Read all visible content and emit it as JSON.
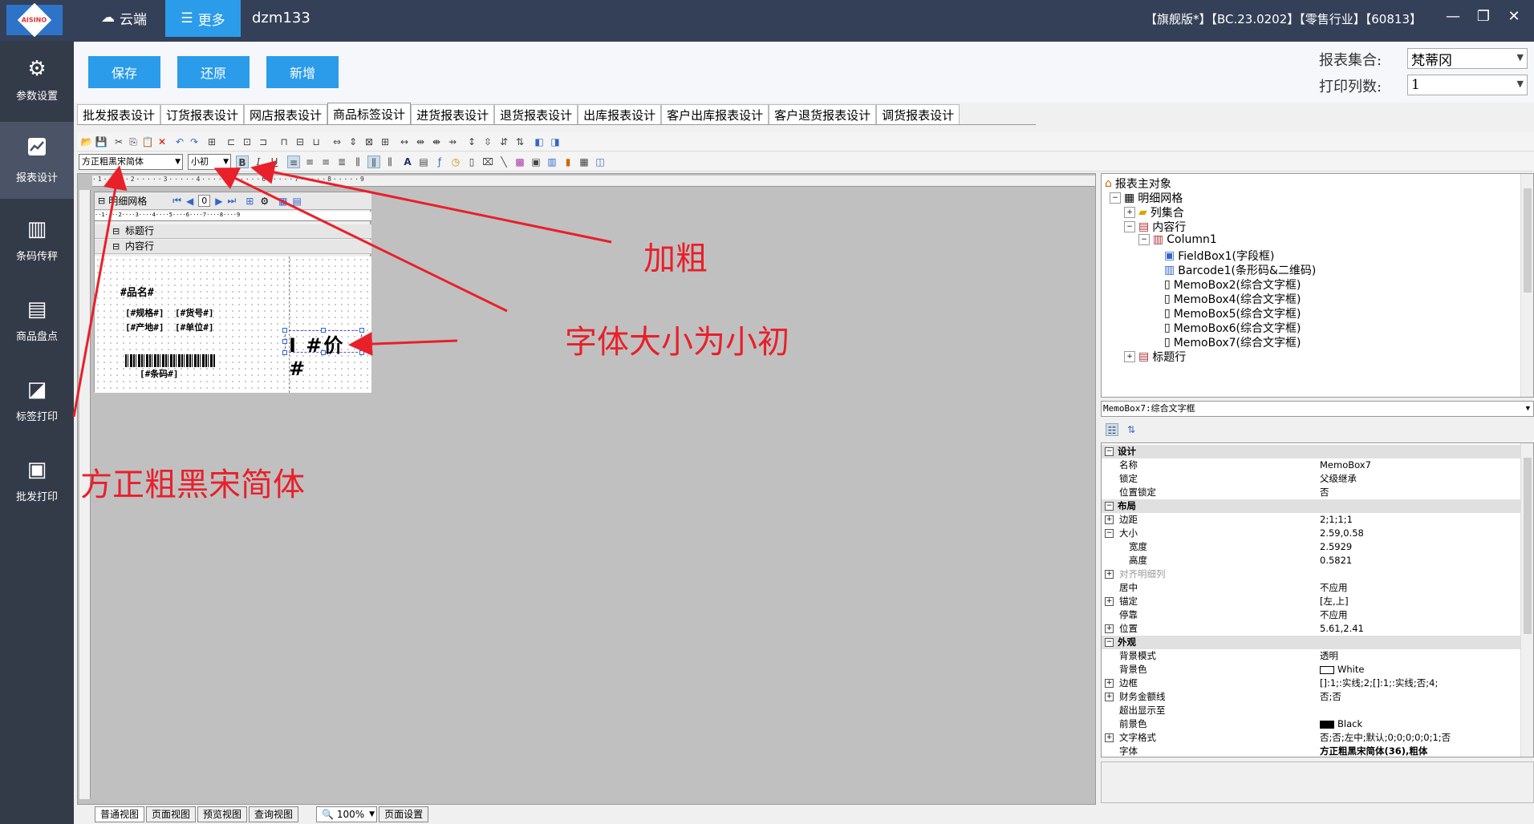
{
  "titlebar": {
    "logo_text": "AISINO",
    "cloud_label": "云端",
    "more_label": "更多",
    "user": "dzm133",
    "info": "【旗舰版*】【BC.23.0202】【零售行业】【60813】",
    "controls": [
      "—",
      "❐",
      "✕"
    ]
  },
  "sidebar": {
    "items": [
      {
        "label": "参数设置",
        "icon": "gear-icon",
        "glyph": "⚙"
      },
      {
        "label": "报表设计",
        "icon": "chart-icon",
        "glyph": "📈"
      },
      {
        "label": "条码传秤",
        "icon": "barcode-icon",
        "glyph": "▥"
      },
      {
        "label": "商品盘点",
        "icon": "inventory-icon",
        "glyph": "▤"
      },
      {
        "label": "标签打印",
        "icon": "label-icon",
        "glyph": "◪"
      },
      {
        "label": "批发打印",
        "icon": "printer-icon",
        "glyph": "▣"
      }
    ]
  },
  "actions": {
    "save": "保存",
    "restore": "还原",
    "add": "新增"
  },
  "report_fields": {
    "set_label": "报表集合:",
    "set_value": "梵蒂冈",
    "cols_label": "打印列数:",
    "cols_value": "1"
  },
  "tabs": [
    "批发报表设计",
    "订货报表设计",
    "网店报表设计",
    "商品标签设计",
    "进货报表设计",
    "退货报表设计",
    "出库报表设计",
    "客户出库报表设计",
    "客户退货报表设计",
    "调货报表设计"
  ],
  "toolbar": {
    "font_name": "方正粗黑宋简体",
    "font_size": "小初",
    "bold": "B",
    "italic": "I",
    "underline": "U"
  },
  "canvas": {
    "grid_title": "明细网格",
    "page_value": "0",
    "header_row": "标题行",
    "content_row": "内容行",
    "fields": {
      "name": "#品名#",
      "spec": "[#规格#]",
      "code": "[#货号#]",
      "origin": "[#产地#]",
      "unit": "[#单位#]",
      "barcode": "[#条码#]",
      "big": "I #价#"
    }
  },
  "statusbar": {
    "tabs": [
      "普通视图",
      "页面视图",
      "预览视图",
      "查询视图"
    ],
    "zoom": "100%",
    "page_setup": "页面设置"
  },
  "tree": {
    "root": "报表主对象",
    "items": [
      "明细网格",
      "列集合",
      "内容行",
      "Column1",
      "FieldBox1(字段框)",
      "Barcode1(条形码&二维码)",
      "MemoBox2(综合文字框)",
      "MemoBox4(综合文字框)",
      "MemoBox5(综合文字框)",
      "MemoBox6(综合文字框)",
      "MemoBox7(综合文字框)",
      "标题行"
    ]
  },
  "props": {
    "title": "MemoBox7:综合文字框",
    "rows": [
      {
        "k": "设计",
        "v": "",
        "cat": true
      },
      {
        "k": "名称",
        "v": "MemoBox7"
      },
      {
        "k": "锁定",
        "v": "父级继承"
      },
      {
        "k": "位置锁定",
        "v": "否"
      },
      {
        "k": "布局",
        "v": "",
        "cat": true
      },
      {
        "k": "边距",
        "v": "2;1;1;1",
        "exp": "+"
      },
      {
        "k": "大小",
        "v": "2.59,0.58",
        "exp": "-"
      },
      {
        "k": "宽度",
        "v": "2.5929",
        "sub": true
      },
      {
        "k": "高度",
        "v": "0.5821",
        "sub": true
      },
      {
        "k": "对齐明细列",
        "v": "",
        "exp": "+",
        "dim": true
      },
      {
        "k": "居中",
        "v": "不应用"
      },
      {
        "k": "锚定",
        "v": "[左,上]",
        "exp": "+"
      },
      {
        "k": "停靠",
        "v": "不应用"
      },
      {
        "k": "位置",
        "v": "5.61,2.41",
        "exp": "+"
      },
      {
        "k": "外观",
        "v": "",
        "cat": true
      },
      {
        "k": "背景模式",
        "v": "透明"
      },
      {
        "k": "背景色",
        "v": "White",
        "swatch": "#ffffff"
      },
      {
        "k": "边框",
        "v": "[]:1;:实线;2;[]:1;:实线;否;4;",
        "exp": "+"
      },
      {
        "k": "财务金额线",
        "v": "否;否",
        "exp": "+"
      },
      {
        "k": "超出显示至",
        "v": ""
      },
      {
        "k": "前景色",
        "v": "Black",
        "swatch": "#000000"
      },
      {
        "k": "文字格式",
        "v": "否;否;左中;默认;0;0;0;0;0;1;否",
        "exp": "+"
      },
      {
        "k": "字体",
        "v": "方正粗黑宋简体(36),粗体",
        "bold": true
      }
    ]
  },
  "annotations": {
    "bold": "加粗",
    "size": "字体大小为小初",
    "font": "方正粗黑宋简体"
  },
  "colors": {
    "titlebar": "#344058",
    "sidebar": "#333a48",
    "accent": "#2b9cea",
    "annotation": "#e8202a"
  }
}
